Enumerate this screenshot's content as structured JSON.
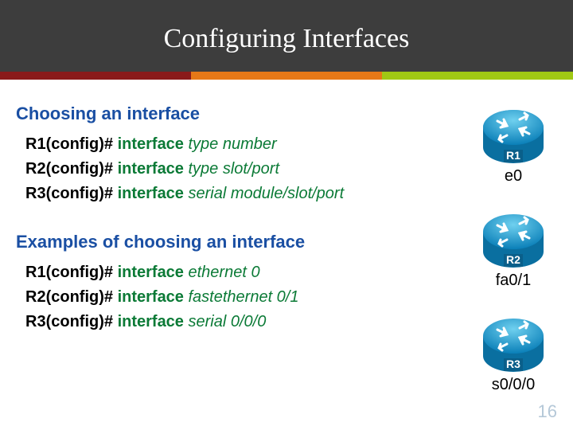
{
  "header": {
    "title": "Configuring Interfaces"
  },
  "section1": {
    "title": "Choosing an interface",
    "lines": [
      {
        "prompt": "R1(config)# ",
        "cmd": "interface ",
        "arg": "type number"
      },
      {
        "prompt": "R2(config)# ",
        "cmd": "interface ",
        "arg": "type slot/port"
      },
      {
        "prompt": "R3(config)# ",
        "cmd": "interface ",
        "arg": "serial module/slot/port"
      }
    ]
  },
  "section2": {
    "title": "Examples of choosing an interface",
    "lines": [
      {
        "prompt": "R1(config)# ",
        "cmd": "interface ",
        "arg": "ethernet 0"
      },
      {
        "prompt": "R2(config)# ",
        "cmd": "interface ",
        "arg": "fastethernet 0/1"
      },
      {
        "prompt": "R3(config)# ",
        "cmd": "interface ",
        "arg": "serial 0/0/0"
      }
    ]
  },
  "routers": [
    {
      "name": "R1",
      "caption": "e0"
    },
    {
      "name": "R2",
      "caption": "fa0/1"
    },
    {
      "name": "R3",
      "caption": "s0/0/0"
    }
  ],
  "pagenum": "16"
}
